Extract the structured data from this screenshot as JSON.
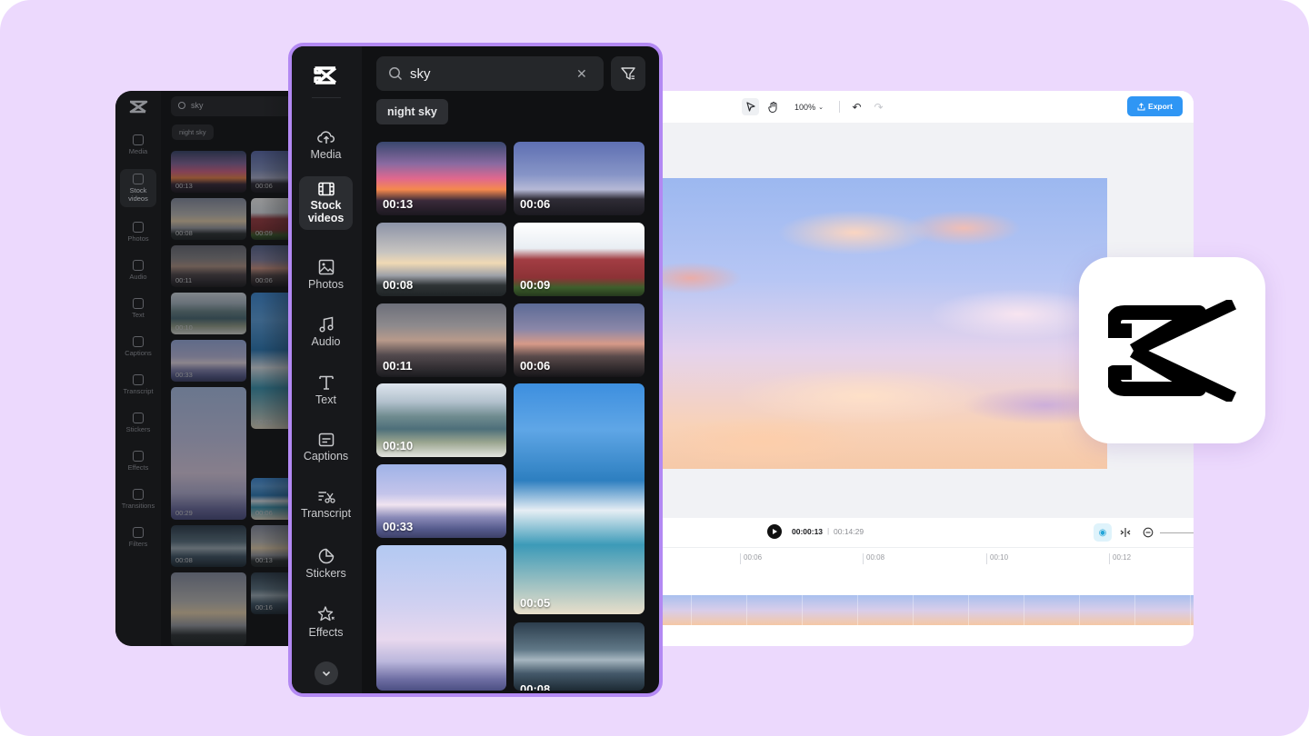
{
  "background_panel": {
    "search_value": "sky",
    "chip": "night sky",
    "rail_items": [
      "Media",
      "Stock videos",
      "Photos",
      "Audio",
      "Text",
      "Captions",
      "Transcript",
      "Stickers",
      "Effects",
      "Transitions",
      "Filters"
    ],
    "durations": [
      "00:13",
      "00:06",
      "00:08",
      "00:09",
      "00:11",
      "00:06",
      "00:10",
      "00:33",
      "00:05",
      "00:29",
      "00:08",
      "00:11",
      "00:06",
      "00:13",
      "00:16"
    ]
  },
  "sidebar": {
    "items": [
      {
        "label": "Media",
        "icon": "cloud-upload-icon"
      },
      {
        "label": "Stock videos",
        "icon": "film-icon",
        "active": true
      },
      {
        "label": "Photos",
        "icon": "image-icon"
      },
      {
        "label": "Audio",
        "icon": "music-note-icon"
      },
      {
        "label": "Text",
        "icon": "text-icon"
      },
      {
        "label": "Captions",
        "icon": "captions-icon"
      },
      {
        "label": "Transcript",
        "icon": "transcript-icon"
      },
      {
        "label": "Stickers",
        "icon": "sticker-icon"
      },
      {
        "label": "Effects",
        "icon": "sparkle-star-icon"
      }
    ]
  },
  "search": {
    "value": "sky",
    "clear_glyph": "✕"
  },
  "suggestion_chip": "night sky",
  "results": {
    "left_column": [
      "00:13",
      "00:08",
      "00:11",
      "00:10",
      "00:33",
      ""
    ],
    "right_column": [
      "00:06",
      "00:09",
      "00:06",
      "",
      "00:05",
      "00:08"
    ]
  },
  "toolbar": {
    "zoom": "100%",
    "export_label": "Export"
  },
  "player": {
    "current_time": "00:00:13",
    "separator": "|",
    "total_time": "00:14:29"
  },
  "timeline": {
    "ticks": [
      "00:06",
      "00:08",
      "00:10",
      "00:12"
    ]
  },
  "colors": {
    "backdrop": "#ecd9fd",
    "panel_border": "#b389f3",
    "export_button": "#2f96f4",
    "panel_bg": "#101113"
  }
}
